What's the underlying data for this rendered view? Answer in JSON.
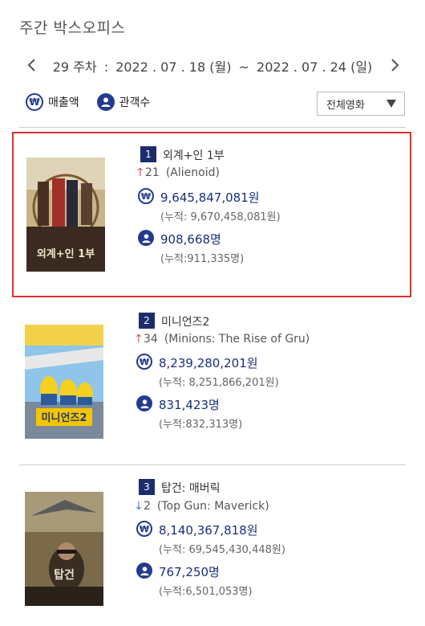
{
  "page_title": "주간 박스오피스",
  "week": {
    "number": "29 주차",
    "separator": ":",
    "start_date": "2022 . 07 . 18 (월)",
    "tilde": "~",
    "end_date": "2022 . 07 . 24 (일)"
  },
  "toggles": {
    "sales_label": "매출액",
    "audience_label": "관객수"
  },
  "filter": {
    "selected": "전체영화"
  },
  "colors": {
    "accent": "#1c2c6c",
    "highlight_border": "#e03030",
    "rank_up": "#e05050",
    "rank_down": "#4a7fd0"
  },
  "movies": [
    {
      "rank": "1",
      "title": "외계+인 1부",
      "change_arrow": "↑",
      "change_value": "21",
      "english_title": "(Alienoid)",
      "sales": "9,645,847,081원",
      "sales_cumulative": "(누적: 9,670,458,081원)",
      "audience": "908,668명",
      "audience_cumulative": "(누적:911,335명)",
      "poster_text": "외계+인 1부"
    },
    {
      "rank": "2",
      "title": "미니언즈2",
      "change_arrow": "↑",
      "change_value": "34",
      "english_title": "(Minions: The Rise of Gru)",
      "sales": "8,239,280,201원",
      "sales_cumulative": "(누적: 8,251,866,201원)",
      "audience": "831,423명",
      "audience_cumulative": "(누적:832,313명)",
      "poster_text": "미니언즈2"
    },
    {
      "rank": "3",
      "title": "탑건: 매버릭",
      "change_arrow": "↓",
      "change_value": "2",
      "english_title": "(Top Gun: Maverick)",
      "sales": "8,140,367,818원",
      "sales_cumulative": "(누적: 69,545,430,448원)",
      "audience": "767,250명",
      "audience_cumulative": "(누적:6,501,053명)",
      "poster_text": "탑건"
    }
  ]
}
